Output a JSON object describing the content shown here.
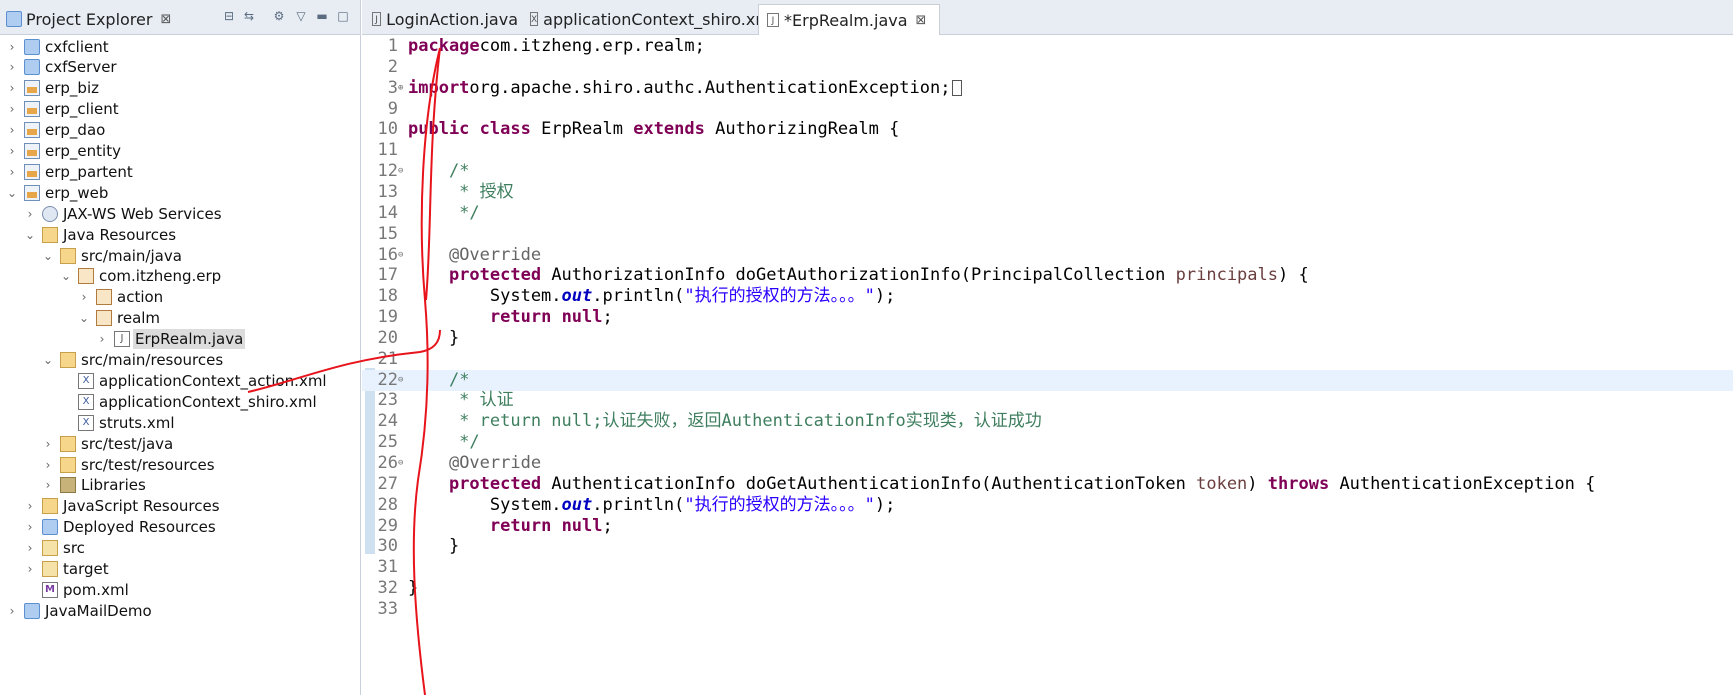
{
  "explorer": {
    "title": "Project Explorer",
    "tree": [
      {
        "label": "cxfclient",
        "icon": "folder-blue-icon",
        "depth": 0,
        "arrow": "collapsed"
      },
      {
        "label": "cxfServer",
        "icon": "folder-blue-icon",
        "depth": 0,
        "arrow": "collapsed"
      },
      {
        "label": "erp_biz",
        "icon": "maven-project-icon",
        "depth": 0,
        "arrow": "collapsed"
      },
      {
        "label": "erp_client",
        "icon": "maven-project-icon",
        "depth": 0,
        "arrow": "collapsed"
      },
      {
        "label": "erp_dao",
        "icon": "maven-project-icon",
        "depth": 0,
        "arrow": "collapsed"
      },
      {
        "label": "erp_entity",
        "icon": "maven-project-icon",
        "depth": 0,
        "arrow": "collapsed"
      },
      {
        "label": "erp_partent",
        "icon": "maven-project-icon",
        "depth": 0,
        "arrow": "collapsed"
      },
      {
        "label": "erp_web",
        "icon": "maven-project-icon",
        "depth": 0,
        "arrow": "expanded"
      },
      {
        "label": "JAX-WS Web Services",
        "icon": "web-services-icon",
        "depth": 1,
        "arrow": "collapsed"
      },
      {
        "label": "Java Resources",
        "icon": "java-resources-icon",
        "depth": 1,
        "arrow": "expanded"
      },
      {
        "label": "src/main/java",
        "icon": "source-folder-icon",
        "depth": 2,
        "arrow": "expanded"
      },
      {
        "label": "com.itzheng.erp",
        "icon": "package-icon",
        "depth": 3,
        "arrow": "expanded"
      },
      {
        "label": "action",
        "icon": "package-icon",
        "depth": 4,
        "arrow": "collapsed"
      },
      {
        "label": "realm",
        "icon": "package-icon",
        "depth": 4,
        "arrow": "expanded"
      },
      {
        "label": "ErpRealm.java",
        "icon": "java-file-icon",
        "depth": 5,
        "arrow": "collapsed",
        "selected": true
      },
      {
        "label": "src/main/resources",
        "icon": "source-folder-icon",
        "depth": 2,
        "arrow": "expanded"
      },
      {
        "label": "applicationContext_action.xml",
        "icon": "xml-file-icon",
        "depth": 3,
        "arrow": "none"
      },
      {
        "label": "applicationContext_shiro.xml",
        "icon": "xml-file-icon",
        "depth": 3,
        "arrow": "none"
      },
      {
        "label": "struts.xml",
        "icon": "xml-file-icon",
        "depth": 3,
        "arrow": "none"
      },
      {
        "label": "src/test/java",
        "icon": "source-folder-icon",
        "depth": 2,
        "arrow": "collapsed"
      },
      {
        "label": "src/test/resources",
        "icon": "source-folder-icon",
        "depth": 2,
        "arrow": "collapsed"
      },
      {
        "label": "Libraries",
        "icon": "library-icon",
        "depth": 2,
        "arrow": "collapsed"
      },
      {
        "label": "JavaScript Resources",
        "icon": "js-resources-icon",
        "depth": 1,
        "arrow": "collapsed"
      },
      {
        "label": "Deployed Resources",
        "icon": "deployed-resources-icon",
        "depth": 1,
        "arrow": "collapsed"
      },
      {
        "label": "src",
        "icon": "folder-icon",
        "depth": 1,
        "arrow": "collapsed"
      },
      {
        "label": "target",
        "icon": "folder-icon",
        "depth": 1,
        "arrow": "collapsed"
      },
      {
        "label": "pom.xml",
        "icon": "maven-pom-icon",
        "depth": 1,
        "arrow": "none"
      },
      {
        "label": "JavaMailDemo",
        "icon": "folder-blue-icon",
        "depth": 0,
        "arrow": "collapsed"
      }
    ]
  },
  "editor": {
    "tabs": [
      {
        "label": "LoginAction.java",
        "icon": "java-file-icon",
        "active": false
      },
      {
        "label": "applicationContext_shiro.xml",
        "icon": "xml-file-icon",
        "active": false
      },
      {
        "label": "*ErpRealm.java",
        "icon": "java-file-icon",
        "active": true
      }
    ],
    "lines": [
      {
        "n": "1",
        "tokens": [
          [
            "kw",
            "package"
          ],
          [
            "",
            "com.itzheng.erp.realm;"
          ]
        ]
      },
      {
        "n": "2",
        "tokens": []
      },
      {
        "n": "3",
        "fold": "+",
        "tokens": [
          [
            "kw",
            "import"
          ],
          [
            "",
            "org.apache.shiro.authc.AuthenticationException;"
          ]
        ],
        "marker": true
      },
      {
        "n": "9",
        "tokens": []
      },
      {
        "n": "10",
        "tokens": [
          [
            "kw",
            "public"
          ],
          [
            "",
            " "
          ],
          [
            "kw",
            "class"
          ],
          [
            "",
            " ErpRealm "
          ],
          [
            "kw",
            "extends"
          ],
          [
            "",
            " AuthorizingRealm {"
          ]
        ]
      },
      {
        "n": "11",
        "tokens": []
      },
      {
        "n": "12",
        "fold": "-",
        "tokens": [
          [
            "",
            "    "
          ],
          [
            "cm",
            "/*"
          ]
        ]
      },
      {
        "n": "13",
        "tokens": [
          [
            "cm",
            "     * 授权"
          ]
        ]
      },
      {
        "n": "14",
        "tokens": [
          [
            "cm",
            "     */"
          ]
        ]
      },
      {
        "n": "15",
        "tokens": []
      },
      {
        "n": "16",
        "fold": "-",
        "tokens": [
          [
            "",
            "    "
          ],
          [
            "ann",
            "@Override"
          ]
        ]
      },
      {
        "n": "17",
        "tokens": [
          [
            "",
            "    "
          ],
          [
            "kw",
            "protected"
          ],
          [
            "",
            " AuthorizationInfo doGetAuthorizationInfo(PrincipalCollection "
          ],
          [
            "par",
            "principals"
          ],
          [
            "",
            ") {"
          ]
        ]
      },
      {
        "n": "18",
        "tokens": [
          [
            "",
            "        System."
          ],
          [
            "fld",
            "out"
          ],
          [
            "",
            ".println("
          ],
          [
            "str",
            "\"执行的授权的方法。。。\""
          ],
          [
            "",
            ");"
          ]
        ]
      },
      {
        "n": "19",
        "tokens": [
          [
            "",
            "        "
          ],
          [
            "kw",
            "return"
          ],
          [
            "",
            " "
          ],
          [
            "kw",
            "null"
          ],
          [
            "",
            ";"
          ]
        ]
      },
      {
        "n": "20",
        "tokens": [
          [
            "",
            "    }"
          ]
        ]
      },
      {
        "n": "21",
        "tokens": []
      },
      {
        "n": "22",
        "fold": "-",
        "hl": true,
        "tokens": [
          [
            "",
            "    "
          ],
          [
            "cm",
            "/*"
          ]
        ]
      },
      {
        "n": "23",
        "tokens": [
          [
            "cm",
            "     * 认证"
          ]
        ]
      },
      {
        "n": "24",
        "tokens": [
          [
            "cm",
            "     * return null;认证失败，返回AuthenticationInfo实现类，认证成功"
          ]
        ]
      },
      {
        "n": "25",
        "tokens": [
          [
            "cm",
            "     */"
          ]
        ]
      },
      {
        "n": "26",
        "fold": "-",
        "tokens": [
          [
            "",
            "    "
          ],
          [
            "ann",
            "@Override"
          ]
        ]
      },
      {
        "n": "27",
        "tokens": [
          [
            "",
            "    "
          ],
          [
            "kw",
            "protected"
          ],
          [
            "",
            " AuthenticationInfo doGetAuthenticationInfo(AuthenticationToken "
          ],
          [
            "par",
            "token"
          ],
          [
            "",
            ") "
          ],
          [
            "kw",
            "throws"
          ],
          [
            "",
            " AuthenticationException {"
          ]
        ]
      },
      {
        "n": "28",
        "tokens": [
          [
            "",
            "        System."
          ],
          [
            "fld",
            "out"
          ],
          [
            "",
            ".println("
          ],
          [
            "str",
            "\"执行的授权的方法。。。\""
          ],
          [
            "",
            ");"
          ]
        ]
      },
      {
        "n": "29",
        "tokens": [
          [
            "",
            "        "
          ],
          [
            "kw",
            "return"
          ],
          [
            "",
            " "
          ],
          [
            "kw",
            "null"
          ],
          [
            "",
            ";"
          ]
        ]
      },
      {
        "n": "30",
        "tokens": [
          [
            "",
            "    }"
          ]
        ]
      },
      {
        "n": "31",
        "tokens": []
      },
      {
        "n": "32",
        "tokens": [
          [
            "",
            "}"
          ]
        ]
      },
      {
        "n": "33",
        "tokens": []
      }
    ]
  },
  "colors": {
    "annotation_stroke": "#e8141c",
    "keyword": "#7f0055",
    "comment": "#3f7f5f",
    "string": "#2a00ff"
  }
}
